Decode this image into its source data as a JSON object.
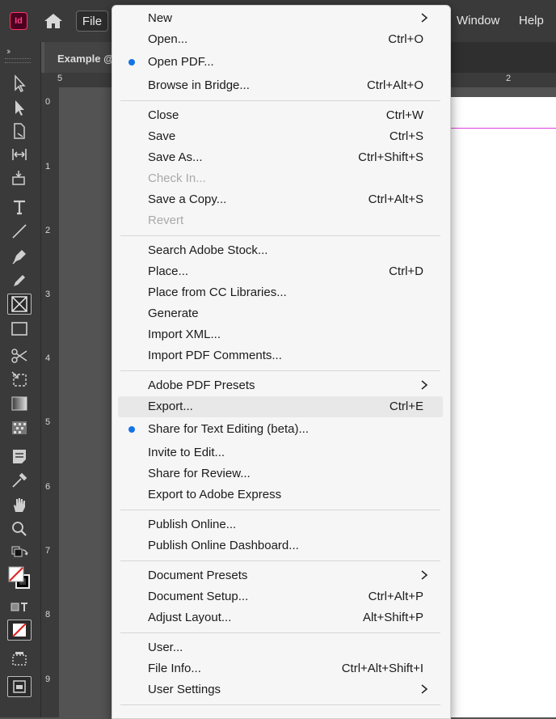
{
  "app": {
    "logo_text": "Id"
  },
  "menubar": {
    "file_label": "File",
    "window_label": "Window",
    "help_label": "Help"
  },
  "document_tab": {
    "title": "Example @"
  },
  "vertical_ruler": {
    "ticks": [
      "0",
      "1",
      "2",
      "3",
      "4",
      "5",
      "6",
      "7",
      "8",
      "9"
    ]
  },
  "horizontal_ruler": {
    "left_label": "5",
    "right_label": "2"
  },
  "file_menu": {
    "new": {
      "label": "New"
    },
    "open": {
      "label": "Open...",
      "shortcut": "Ctrl+O"
    },
    "open_pdf": {
      "label": "Open PDF..."
    },
    "browse_bridge": {
      "label": "Browse in Bridge...",
      "shortcut": "Ctrl+Alt+O"
    },
    "close": {
      "label": "Close",
      "shortcut": "Ctrl+W"
    },
    "save": {
      "label": "Save",
      "shortcut": "Ctrl+S"
    },
    "save_as": {
      "label": "Save As...",
      "shortcut": "Ctrl+Shift+S"
    },
    "check_in": {
      "label": "Check In..."
    },
    "save_copy": {
      "label": "Save a Copy...",
      "shortcut": "Ctrl+Alt+S"
    },
    "revert": {
      "label": "Revert"
    },
    "search_stock": {
      "label": "Search Adobe Stock..."
    },
    "place": {
      "label": "Place...",
      "shortcut": "Ctrl+D"
    },
    "place_cc": {
      "label": "Place from CC Libraries..."
    },
    "generate": {
      "label": "Generate"
    },
    "import_xml": {
      "label": "Import XML..."
    },
    "import_pdf_comments": {
      "label": "Import PDF Comments..."
    },
    "pdf_presets": {
      "label": "Adobe PDF Presets"
    },
    "export": {
      "label": "Export...",
      "shortcut": "Ctrl+E"
    },
    "share_text": {
      "label": "Share for Text Editing (beta)..."
    },
    "invite": {
      "label": "Invite to Edit..."
    },
    "share_review": {
      "label": "Share for Review..."
    },
    "export_express": {
      "label": "Export to Adobe Express"
    },
    "publish_online": {
      "label": "Publish Online..."
    },
    "publish_dashboard": {
      "label": "Publish Online Dashboard..."
    },
    "doc_presets": {
      "label": "Document Presets"
    },
    "doc_setup": {
      "label": "Document Setup...",
      "shortcut": "Ctrl+Alt+P"
    },
    "adjust_layout": {
      "label": "Adjust Layout...",
      "shortcut": "Alt+Shift+P"
    },
    "user": {
      "label": "User..."
    },
    "file_info": {
      "label": "File Info...",
      "shortcut": "Ctrl+Alt+Shift+I"
    },
    "user_settings": {
      "label": "User Settings"
    }
  },
  "colors": {
    "accent_dot": "#1473e6",
    "app_brand": "#ff3366",
    "guide": "#e040e0"
  }
}
